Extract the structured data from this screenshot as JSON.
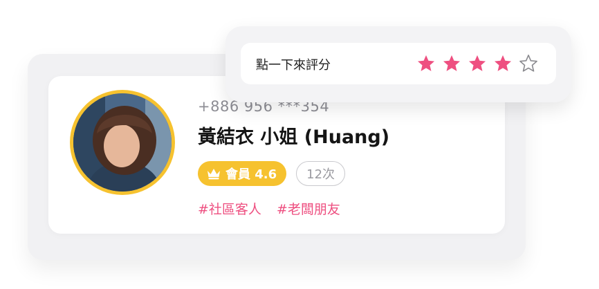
{
  "customer": {
    "phone": "+886 956 ***354",
    "name": "黃結衣 小姐 (Huang)",
    "member_label": "會員 4.6",
    "visits_label": "12次",
    "tags": [
      "#社區客人",
      "#老闆朋友"
    ]
  },
  "rating": {
    "prompt": "點一下來評分",
    "value": 4,
    "max": 5
  },
  "colors": {
    "accent_pink": "#ee4f80",
    "member_gold": "#f6c22f"
  },
  "icons": {
    "member": "crown-icon",
    "star_filled": "star-filled-icon",
    "star_empty": "star-outline-icon"
  }
}
